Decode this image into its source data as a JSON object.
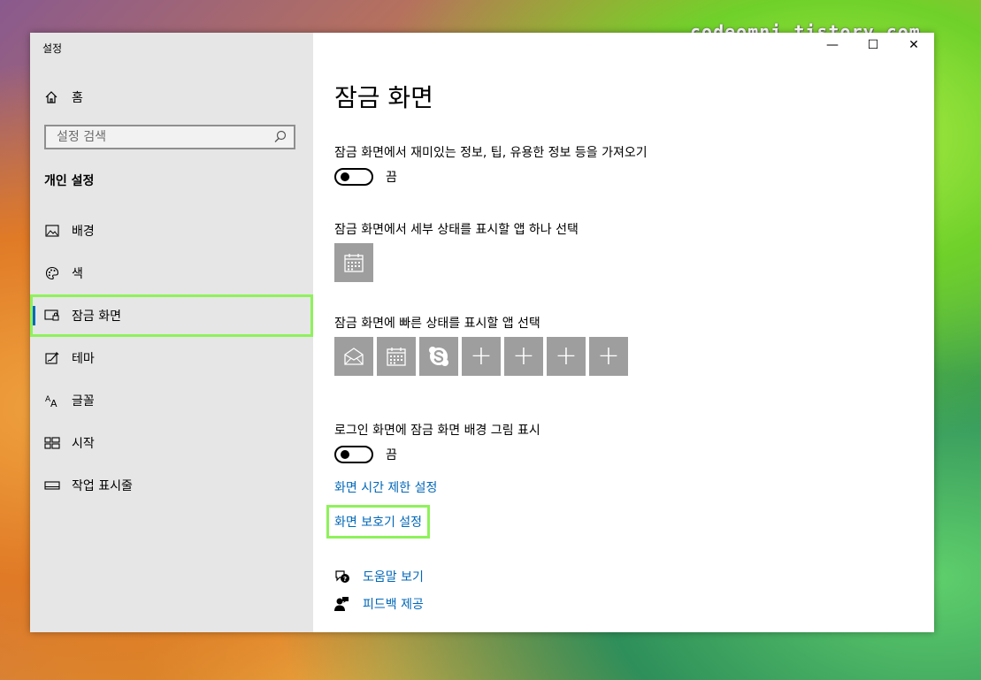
{
  "watermark": "codeomni.tistory.com",
  "window": {
    "title": "설정",
    "controls": {
      "minimize": "—",
      "maximize": "☐",
      "close": "✕"
    }
  },
  "sidebar": {
    "home_label": "홈",
    "search_placeholder": "설정 검색",
    "section_heading": "개인 설정",
    "items": [
      {
        "label": "배경",
        "icon": "picture-icon"
      },
      {
        "label": "색",
        "icon": "palette-icon"
      },
      {
        "label": "잠금 화면",
        "icon": "lock-screen-icon",
        "selected": true
      },
      {
        "label": "테마",
        "icon": "theme-icon"
      },
      {
        "label": "글꼴",
        "icon": "font-icon"
      },
      {
        "label": "시작",
        "icon": "start-icon"
      },
      {
        "label": "작업 표시줄",
        "icon": "taskbar-icon"
      }
    ]
  },
  "main": {
    "title": "잠금 화면",
    "fun_facts": {
      "label": "잠금 화면에서 재미있는 정보, 팁, 유용한 정보 등을 가져오기",
      "toggle_state": "끔"
    },
    "detailed_status_label": "잠금 화면에서 세부 상태를 표시할 앱 하나 선택",
    "quick_status_label": "잠금 화면에 빠른 상태를 표시할 앱 선택",
    "quick_status_tiles": [
      "mail-icon",
      "calendar-icon",
      "skype-icon",
      "plus",
      "plus",
      "plus",
      "plus"
    ],
    "plus_glyph": "+",
    "signin_background": {
      "label": "로그인 화면에 잠금 화면 배경 그림 표시",
      "toggle_state": "끔"
    },
    "screen_timeout_link": "화면 시간 제한 설정",
    "screensaver_link": "화면 보호기 설정",
    "help_link": "도움말 보기",
    "feedback_link": "피드백 제공"
  },
  "colors": {
    "accent": "#0067b8",
    "highlight": "#8ef25a",
    "sidebar_bg": "#e6e6e6",
    "tile_bg": "#9e9e9e"
  }
}
